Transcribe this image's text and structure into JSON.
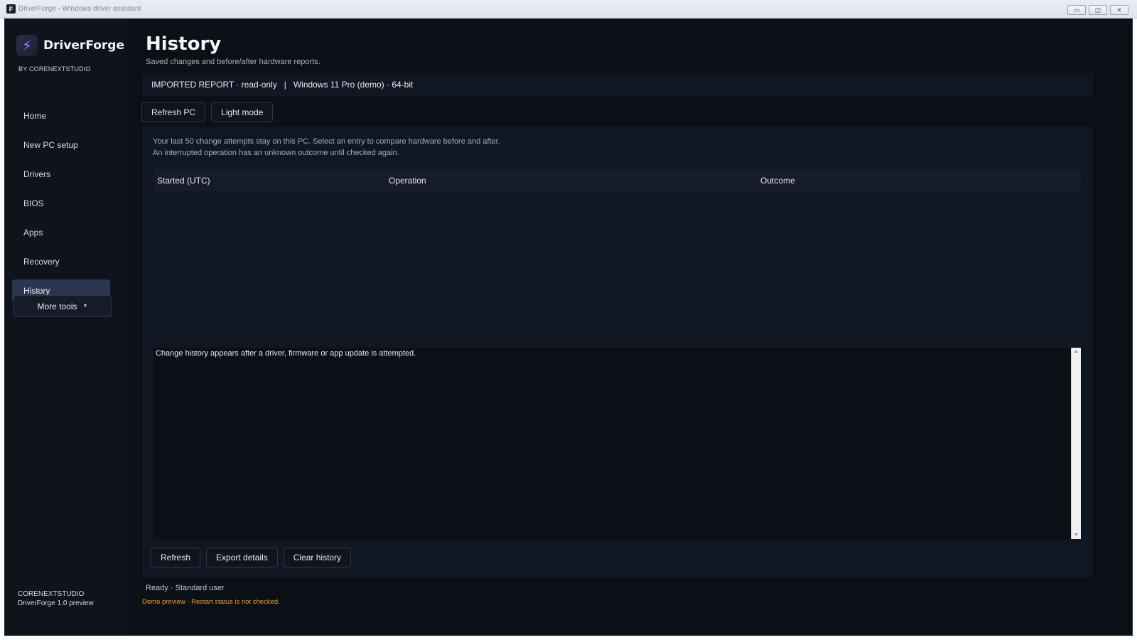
{
  "window": {
    "title": "DriverForge - Windows driver assistant",
    "icon_glyph": "F",
    "controls": {
      "minimize": "▭",
      "restore": "◫",
      "close": "✕"
    }
  },
  "sidebar": {
    "brand_logo_glyph": "⚡",
    "brand_name": "DriverForge",
    "brand_sub": "BY CORENEXTSTUDIO",
    "items": [
      {
        "label": "Home"
      },
      {
        "label": "New PC setup"
      },
      {
        "label": "Drivers"
      },
      {
        "label": "BIOS"
      },
      {
        "label": "Apps"
      },
      {
        "label": "Recovery"
      },
      {
        "label": "History",
        "active": true
      }
    ],
    "more_tools_label": "More tools",
    "more_tools_caret": "▼",
    "footer_company": "CORENEXTSTUDIO",
    "footer_version": "DriverForge 1.0 preview"
  },
  "main": {
    "title": "History",
    "subtitle": "Saved changes and before/after hardware reports.",
    "report_status": "IMPORTED REPORT · read-only",
    "report_separator": "|",
    "report_os": "Windows 11 Pro (demo) · 64-bit",
    "toolbar": {
      "refresh_pc_label": "Refresh PC",
      "light_mode_label": "Light mode"
    },
    "panel": {
      "description_line1": "Your last 50 change attempts stay on this PC. Select an entry to compare hardware before and after.",
      "description_line2": "An interrupted operation has an unknown outcome until checked again.",
      "columns": [
        "Started (UTC)",
        "Operation",
        "Outcome"
      ],
      "details_text": "Change history appears after a driver, firmware or app update is attempted.",
      "scroll_up": "▲",
      "scroll_down": "▼",
      "actions": {
        "refresh_label": "Refresh",
        "export_label": "Export details",
        "clear_label": "Clear history"
      }
    },
    "status": "Ready · Standard user",
    "warning": "Demo preview · Restart status is not checked."
  },
  "colors": {
    "background": "#0b0f16",
    "sidebar": "#0f141c",
    "active_nav": "#2d3650",
    "accent_logo": "#a77bff",
    "warning": "#e6a23c"
  }
}
